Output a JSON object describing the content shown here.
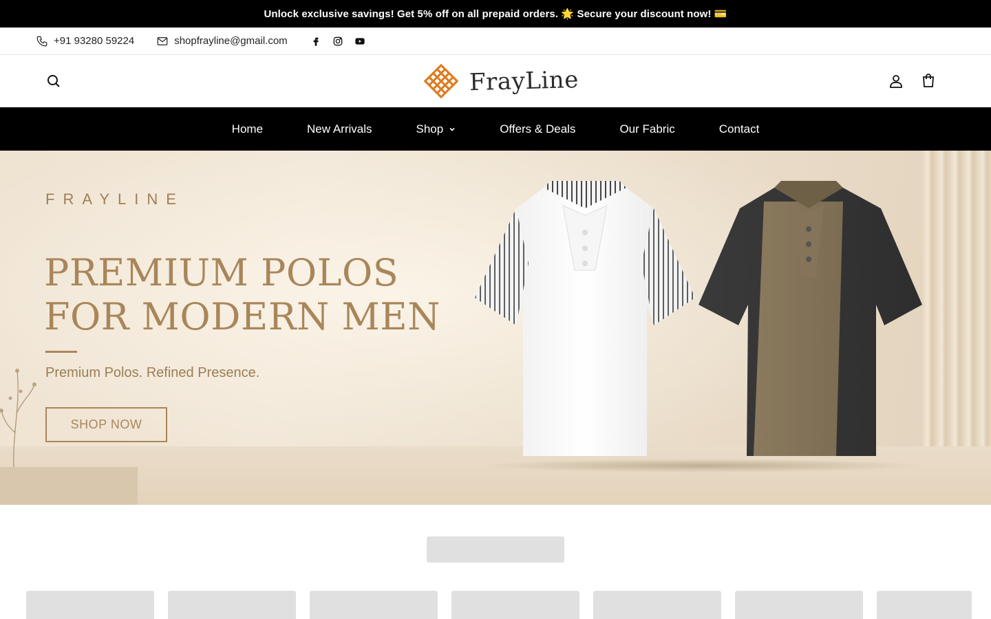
{
  "announcement": {
    "text": "Unlock exclusive savings! Get 5% off on all prepaid orders. 🌟 Secure your discount now! 💳"
  },
  "topbar": {
    "phone": "+91 93280 59224",
    "phone_icon": "phone-icon",
    "email": "shopfrayline@gmail.com",
    "email_icon": "mail-icon",
    "socials": [
      "facebook-icon",
      "instagram-icon",
      "youtube-icon"
    ]
  },
  "header": {
    "logo_text": "FrayLine",
    "search_icon": "search-icon",
    "account_icon": "user-icon",
    "cart_icon": "shopping-bag-icon",
    "logo_color": "#e07a1f"
  },
  "nav": {
    "items": [
      {
        "label": "Home"
      },
      {
        "label": "New Arrivals"
      },
      {
        "label": "Shop",
        "has_dropdown": true
      },
      {
        "label": "Offers & Deals"
      },
      {
        "label": "Our Fabric"
      },
      {
        "label": "Contact"
      }
    ]
  },
  "hero": {
    "brandmark": "FRAYLINE",
    "headline_line1": "PREMIUM POLOS",
    "headline_line2": "FOR MODERN MEN",
    "tagline": "Premium Polos. Refined Presence.",
    "cta_label": "SHOP NOW",
    "accent_color": "#a9865a"
  },
  "colors": {
    "announce_bg": "#000000",
    "nav_bg": "#000000",
    "skeleton": "#e0e0e0"
  }
}
